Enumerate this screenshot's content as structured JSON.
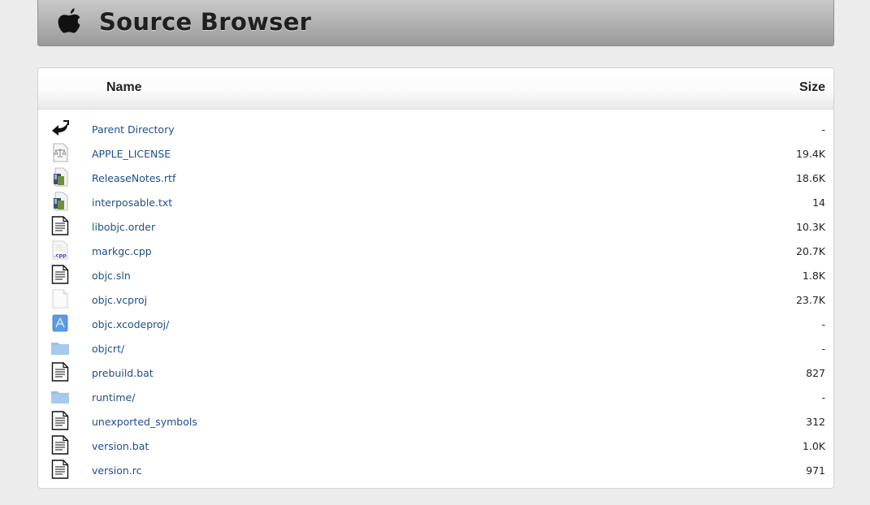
{
  "header": {
    "title": "Source Browser"
  },
  "table": {
    "col_name": "Name",
    "col_size": "Size",
    "rows": [
      {
        "name": "Parent Directory",
        "size": "-",
        "icon": "back-arrow-icon"
      },
      {
        "name": "APPLE_LICENSE",
        "size": "19.4K",
        "icon": "license-icon"
      },
      {
        "name": "ReleaseNotes.rtf",
        "size": "18.6K",
        "icon": "rtf-icon"
      },
      {
        "name": "interposable.txt",
        "size": "14",
        "icon": "rtf-icon"
      },
      {
        "name": "libobjc.order",
        "size": "10.3K",
        "icon": "text-file-icon"
      },
      {
        "name": "markgc.cpp",
        "size": "20.7K",
        "icon": "cpp-file-icon"
      },
      {
        "name": "objc.sln",
        "size": "1.8K",
        "icon": "text-file-icon"
      },
      {
        "name": "objc.vcproj",
        "size": "23.7K",
        "icon": "blank-file-icon"
      },
      {
        "name": "objc.xcodeproj/",
        "size": "-",
        "icon": "xcode-project-icon"
      },
      {
        "name": "objcrt/",
        "size": "-",
        "icon": "folder-icon"
      },
      {
        "name": "prebuild.bat",
        "size": "827",
        "icon": "text-file-icon"
      },
      {
        "name": "runtime/",
        "size": "-",
        "icon": "folder-icon"
      },
      {
        "name": "unexported_symbols",
        "size": "312",
        "icon": "text-file-icon"
      },
      {
        "name": "version.bat",
        "size": "1.0K",
        "icon": "text-file-icon"
      },
      {
        "name": "version.rc",
        "size": "971",
        "icon": "text-file-icon"
      }
    ]
  },
  "cpp_badge": ".cpp",
  "colors": {
    "link": "#1f4e8a",
    "background": "#ececec",
    "header_bar": "#b4b4b4"
  }
}
